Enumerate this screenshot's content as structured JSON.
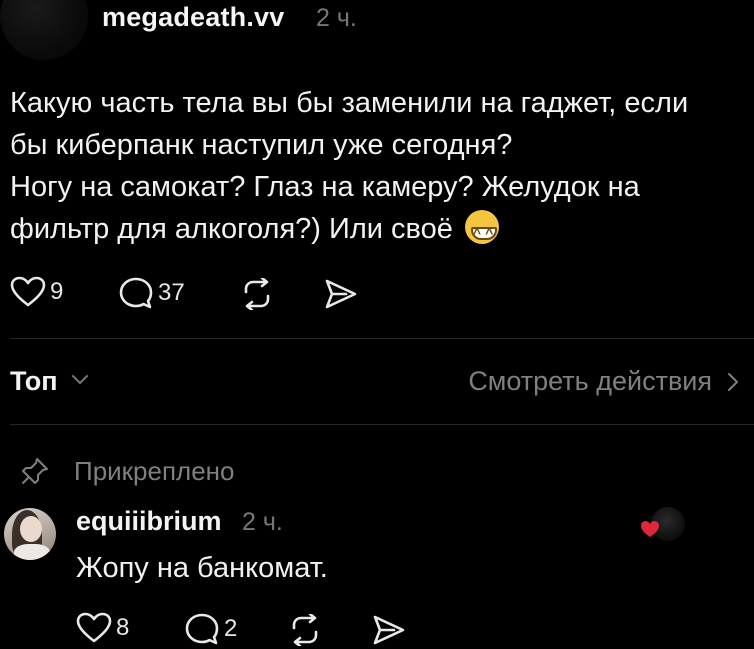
{
  "post": {
    "username": "megadeath.vv",
    "time": "2 ч.",
    "text_line1": "Какую часть тела вы бы заменили на гаджет, если",
    "text_line2": "бы киберпанк наступил уже сегодня?",
    "text_line3": "Ногу на самокат? Глаз на камеру? Желудок на",
    "text_line4": "фильтр для алкоголя?) Или своё",
    "emoji": "grinning-face-emoji",
    "likes": "9",
    "replies": "37"
  },
  "sort": {
    "label": "Топ",
    "activity_label": "Смотреть действия"
  },
  "pinned": {
    "label": "Прикреплено"
  },
  "comment": {
    "username": "equiiibrium",
    "time": "2 ч.",
    "text": "Жопу на банкомат.",
    "likes": "8",
    "replies": "2",
    "liked_by_author_badge": "heart-icon"
  },
  "colors": {
    "background": "#000000",
    "muted": "#808080",
    "heart": "#e0263a"
  }
}
